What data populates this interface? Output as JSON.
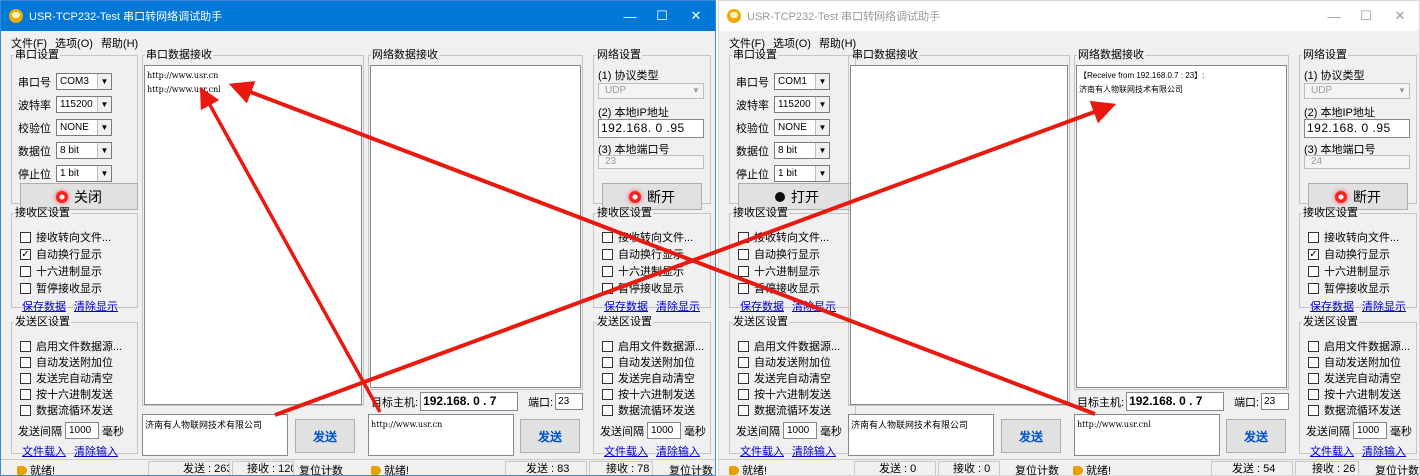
{
  "windows": [
    {
      "title": "USR-TCP232-Test 串口转网络调试助手",
      "menu": [
        "文件(F)",
        "选项(O)",
        "帮助(H)"
      ],
      "serial_settings": {
        "legend": "串口设置",
        "rows": [
          {
            "label": "串口号",
            "value": "COM3"
          },
          {
            "label": "波特率",
            "value": "115200"
          },
          {
            "label": "校验位",
            "value": "NONE"
          },
          {
            "label": "数据位",
            "value": "8 bit"
          },
          {
            "label": "停止位",
            "value": "1 bit"
          }
        ],
        "button": "关闭",
        "lamp": "red-lamp-icon"
      },
      "serial_recv": {
        "legend": "串口数据接收",
        "text": "http://www.usr.cn\nhttp://www.usr.cnl"
      },
      "net_recv": {
        "legend": "网络数据接收",
        "text": ""
      },
      "serial_rx_settings": {
        "legend": "接收区设置",
        "options": [
          {
            "label": "接收转向文件...",
            "checked": ""
          },
          {
            "label": "自动换行显示",
            "checked": "✓"
          },
          {
            "label": "十六进制显示",
            "checked": ""
          },
          {
            "label": "暂停接收显示",
            "checked": ""
          }
        ],
        "link_save": "保存数据",
        "link_clear": "清除显示"
      },
      "serial_tx_settings": {
        "legend": "发送区设置",
        "options": [
          {
            "label": "启用文件数据源...",
            "checked": ""
          },
          {
            "label": "自动发送附加位",
            "checked": ""
          },
          {
            "label": "发送完自动清空",
            "checked": ""
          },
          {
            "label": "按十六进制发送",
            "checked": ""
          },
          {
            "label": "数据流循环发送",
            "checked": ""
          }
        ],
        "interval_label": "发送间隔",
        "interval_value": "1000",
        "interval_unit": "毫秒",
        "link_load": "文件载入",
        "link_clear": "清除输入"
      },
      "net_settings": {
        "legend": "网络设置",
        "protocol_label": "(1) 协议类型",
        "protocol_value": "UDP",
        "ip_label": "(2) 本地IP地址",
        "ip_value": "192.168. 0 .95",
        "port_label": "(3) 本地端口号",
        "port_value": "23",
        "button": "断开",
        "lamp": "red-lamp-icon"
      },
      "net_rx_settings": {
        "legend": "接收区设置",
        "options": [
          {
            "label": "接收转向文件...",
            "checked": ""
          },
          {
            "label": "自动换行显示",
            "checked": ""
          },
          {
            "label": "十六进制显示",
            "checked": ""
          },
          {
            "label": "暂停接收显示",
            "checked": ""
          }
        ],
        "link_save": "保存数据",
        "link_clear": "清除显示"
      },
      "net_tx_settings": {
        "legend": "发送区设置",
        "options": [
          {
            "label": "启用文件数据源...",
            "checked": ""
          },
          {
            "label": "自动发送附加位",
            "checked": ""
          },
          {
            "label": "发送完自动清空",
            "checked": ""
          },
          {
            "label": "按十六进制发送",
            "checked": ""
          },
          {
            "label": "数据流循环发送",
            "checked": ""
          }
        ],
        "interval_label": "发送间隔",
        "interval_value": "1000",
        "interval_unit": "毫秒",
        "link_load": "文件载入",
        "link_clear": "清除输入"
      },
      "target": {
        "label": "目标主机:",
        "ip": "192.168. 0 . 7",
        "port_label": "端口:",
        "port": "23"
      },
      "serial_send": {
        "text": "济南有人物联网技术有限公司",
        "button": "发送"
      },
      "net_send": {
        "text": "http://www.usr.cn",
        "button": "发送"
      },
      "status": {
        "ready1": "就绪!",
        "sent1": "发送 : 263",
        "recv1": "接收 : 120",
        "reset1": "复位计数",
        "ready2": "就绪!",
        "sent2": "发送 : 83",
        "recv2": "接收 : 78",
        "reset2": "复位计数"
      }
    },
    {
      "title": "USR-TCP232-Test 串口转网络调试助手",
      "menu": [
        "文件(F)",
        "选项(O)",
        "帮助(H)"
      ],
      "serial_settings": {
        "legend": "串口设置",
        "rows": [
          {
            "label": "串口号",
            "value": "COM1"
          },
          {
            "label": "波特率",
            "value": "115200"
          },
          {
            "label": "校验位",
            "value": "NONE"
          },
          {
            "label": "数据位",
            "value": "8 bit"
          },
          {
            "label": "停止位",
            "value": "1 bit"
          }
        ],
        "button": "打开",
        "lamp": "black-lamp-icon"
      },
      "serial_recv": {
        "legend": "串口数据接收",
        "text": ""
      },
      "net_recv": {
        "legend": "网络数据接收",
        "text": "【Receive from 192.168.0.7 : 23】:\n济南有人物联网技术有限公司"
      },
      "serial_rx_settings": {
        "legend": "接收区设置",
        "options": [
          {
            "label": "接收转向文件...",
            "checked": ""
          },
          {
            "label": "自动换行显示",
            "checked": ""
          },
          {
            "label": "十六进制显示",
            "checked": ""
          },
          {
            "label": "暂停接收显示",
            "checked": ""
          }
        ],
        "link_save": "保存数据",
        "link_clear": "清除显示"
      },
      "serial_tx_settings": {
        "legend": "发送区设置",
        "options": [
          {
            "label": "启用文件数据源...",
            "checked": ""
          },
          {
            "label": "自动发送附加位",
            "checked": ""
          },
          {
            "label": "发送完自动清空",
            "checked": ""
          },
          {
            "label": "按十六进制发送",
            "checked": ""
          },
          {
            "label": "数据流循环发送",
            "checked": ""
          }
        ],
        "interval_label": "发送间隔",
        "interval_value": "1000",
        "interval_unit": "毫秒",
        "link_load": "文件载入",
        "link_clear": "清除输入"
      },
      "net_settings": {
        "legend": "网络设置",
        "protocol_label": "(1) 协议类型",
        "protocol_value": "UDP",
        "ip_label": "(2) 本地IP地址",
        "ip_value": "192.168. 0 .95",
        "port_label": "(3) 本地端口号",
        "port_value": "24",
        "button": "断开",
        "lamp": "red-lamp-icon"
      },
      "net_rx_settings": {
        "legend": "接收区设置",
        "options": [
          {
            "label": "接收转向文件...",
            "checked": ""
          },
          {
            "label": "自动换行显示",
            "checked": "✓"
          },
          {
            "label": "十六进制显示",
            "checked": ""
          },
          {
            "label": "暂停接收显示",
            "checked": ""
          }
        ],
        "link_save": "保存数据",
        "link_clear": "清除显示"
      },
      "net_tx_settings": {
        "legend": "发送区设置",
        "options": [
          {
            "label": "启用文件数据源...",
            "checked": ""
          },
          {
            "label": "自动发送附加位",
            "checked": ""
          },
          {
            "label": "发送完自动清空",
            "checked": ""
          },
          {
            "label": "按十六进制发送",
            "checked": ""
          },
          {
            "label": "数据流循环发送",
            "checked": ""
          }
        ],
        "interval_label": "发送间隔",
        "interval_value": "1000",
        "interval_unit": "毫秒",
        "link_load": "文件载入",
        "link_clear": "清除输入"
      },
      "target": {
        "label": "目标主机:",
        "ip": "192.168. 0 . 7",
        "port_label": "端口:",
        "port": "23"
      },
      "serial_send": {
        "text": "济南有人物联网技术有限公司",
        "button": "发送"
      },
      "net_send": {
        "text": "http://www.usr.cnl",
        "button": "发送"
      },
      "status": {
        "ready1": "就绪!",
        "sent1": "发送 : 0",
        "recv1": "接收 : 0",
        "reset1": "复位计数",
        "ready2": "就绪!",
        "sent2": "发送 : 54",
        "recv2": "接收 : 26",
        "reset2": "复位计数"
      }
    }
  ],
  "annotations": {
    "arrow_color": "#e8190f"
  }
}
